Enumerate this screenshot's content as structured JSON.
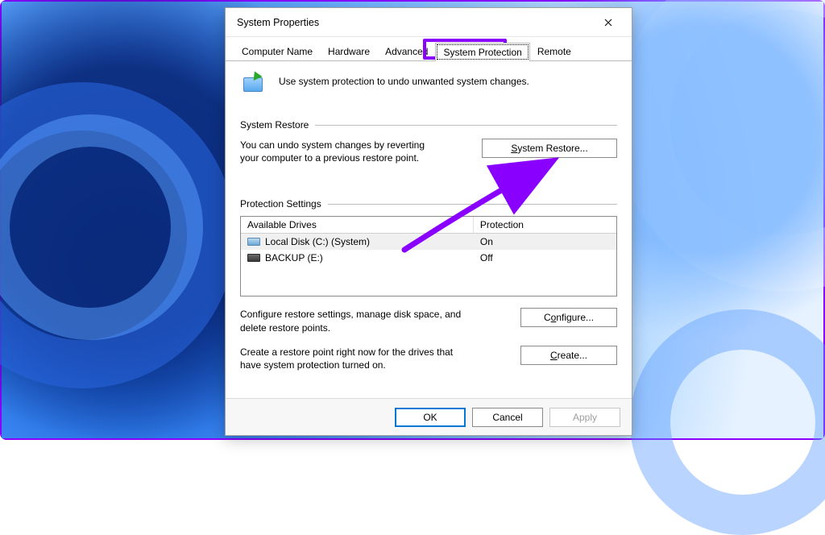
{
  "window": {
    "title": "System Properties"
  },
  "tabs": {
    "items": [
      {
        "label": "Computer Name"
      },
      {
        "label": "Hardware"
      },
      {
        "label": "Advanced"
      },
      {
        "label": "System Protection"
      },
      {
        "label": "Remote"
      }
    ],
    "active_index": 3
  },
  "intro": {
    "text": "Use system protection to undo unwanted system changes."
  },
  "sections": {
    "restore": {
      "title": "System Restore",
      "description": "You can undo system changes by reverting your computer to a previous restore point.",
      "button": "System Restore..."
    },
    "protection": {
      "title": "Protection Settings",
      "columns": {
        "drive": "Available Drives",
        "protection": "Protection"
      },
      "rows": [
        {
          "name": "Local Disk (C:) (System)",
          "protection": "On",
          "icon": "light",
          "selected": true
        },
        {
          "name": "BACKUP (E:)",
          "protection": "Off",
          "icon": "dark",
          "selected": false
        }
      ],
      "configure_text": "Configure restore settings, manage disk space, and delete restore points.",
      "configure_button": "Configure...",
      "create_text": "Create a restore point right now for the drives that have system protection turned on.",
      "create_button": "Create..."
    }
  },
  "footer": {
    "ok": "OK",
    "cancel": "Cancel",
    "apply": "Apply"
  },
  "annotation": {
    "highlight_tab": "System Protection",
    "arrow_target": "System Restore button",
    "color": "#8a00ff"
  }
}
